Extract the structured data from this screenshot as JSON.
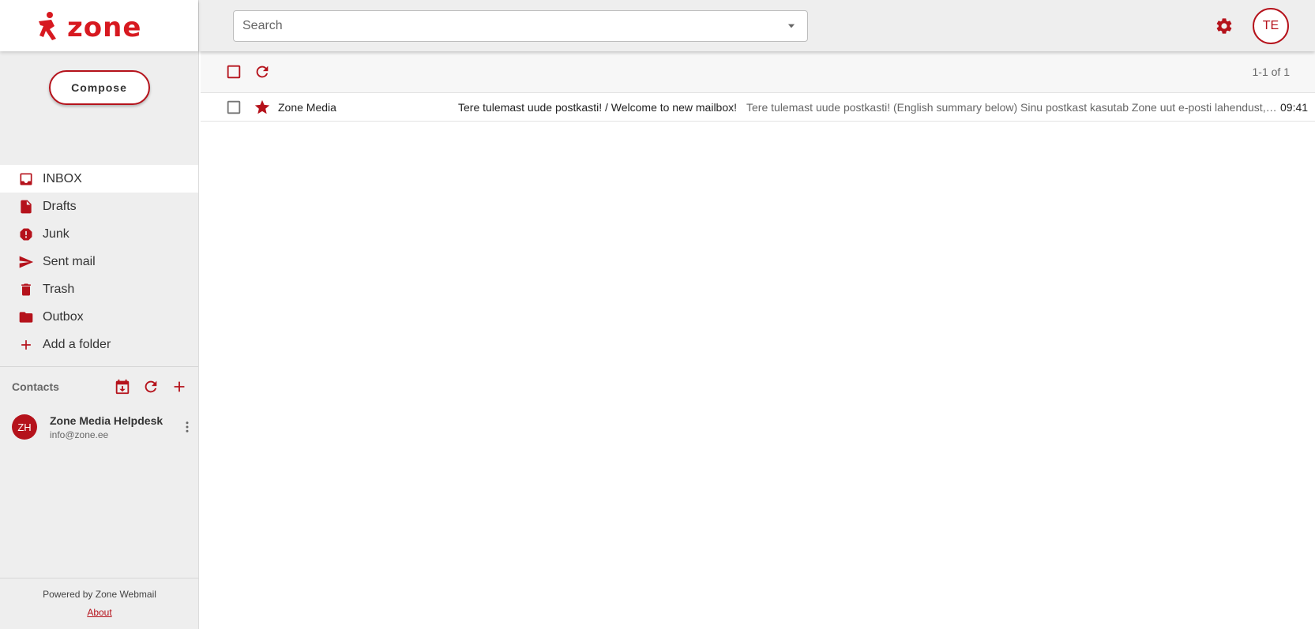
{
  "brand": {
    "logo_text": "zone",
    "accent_color": "#b5121b"
  },
  "search": {
    "placeholder": "Search"
  },
  "user": {
    "initials": "TE"
  },
  "sidebar": {
    "compose_label": "Compose",
    "folders": [
      {
        "label": "INBOX",
        "icon": "inbox-icon",
        "active": true
      },
      {
        "label": "Drafts",
        "icon": "draft-icon"
      },
      {
        "label": "Junk",
        "icon": "junk-icon"
      },
      {
        "label": "Sent mail",
        "icon": "send-icon"
      },
      {
        "label": "Trash",
        "icon": "trash-icon"
      },
      {
        "label": "Outbox",
        "icon": "folder-icon"
      },
      {
        "label": "Add a folder",
        "icon": "plus-icon"
      }
    ],
    "contacts": {
      "title": "Contacts",
      "items": [
        {
          "initials": "ZH",
          "name": "Zone Media Helpdesk",
          "email": "info@zone.ee"
        }
      ]
    },
    "footer": {
      "powered_by": "Powered by Zone Webmail",
      "about": "About"
    }
  },
  "mail_list": {
    "range_label": "1-1 of 1",
    "messages": [
      {
        "sender": "Zone Media",
        "subject": "Tere tulemast uude postkasti! / Welcome to new mailbox!",
        "snippet": "Tere tulemast uude postkasti! (English summary below) Sinu postkast kasutab Zone uut e-posti lahendust, mille abil saad lihtsalt",
        "time": "09:41",
        "starred": true
      }
    ]
  }
}
